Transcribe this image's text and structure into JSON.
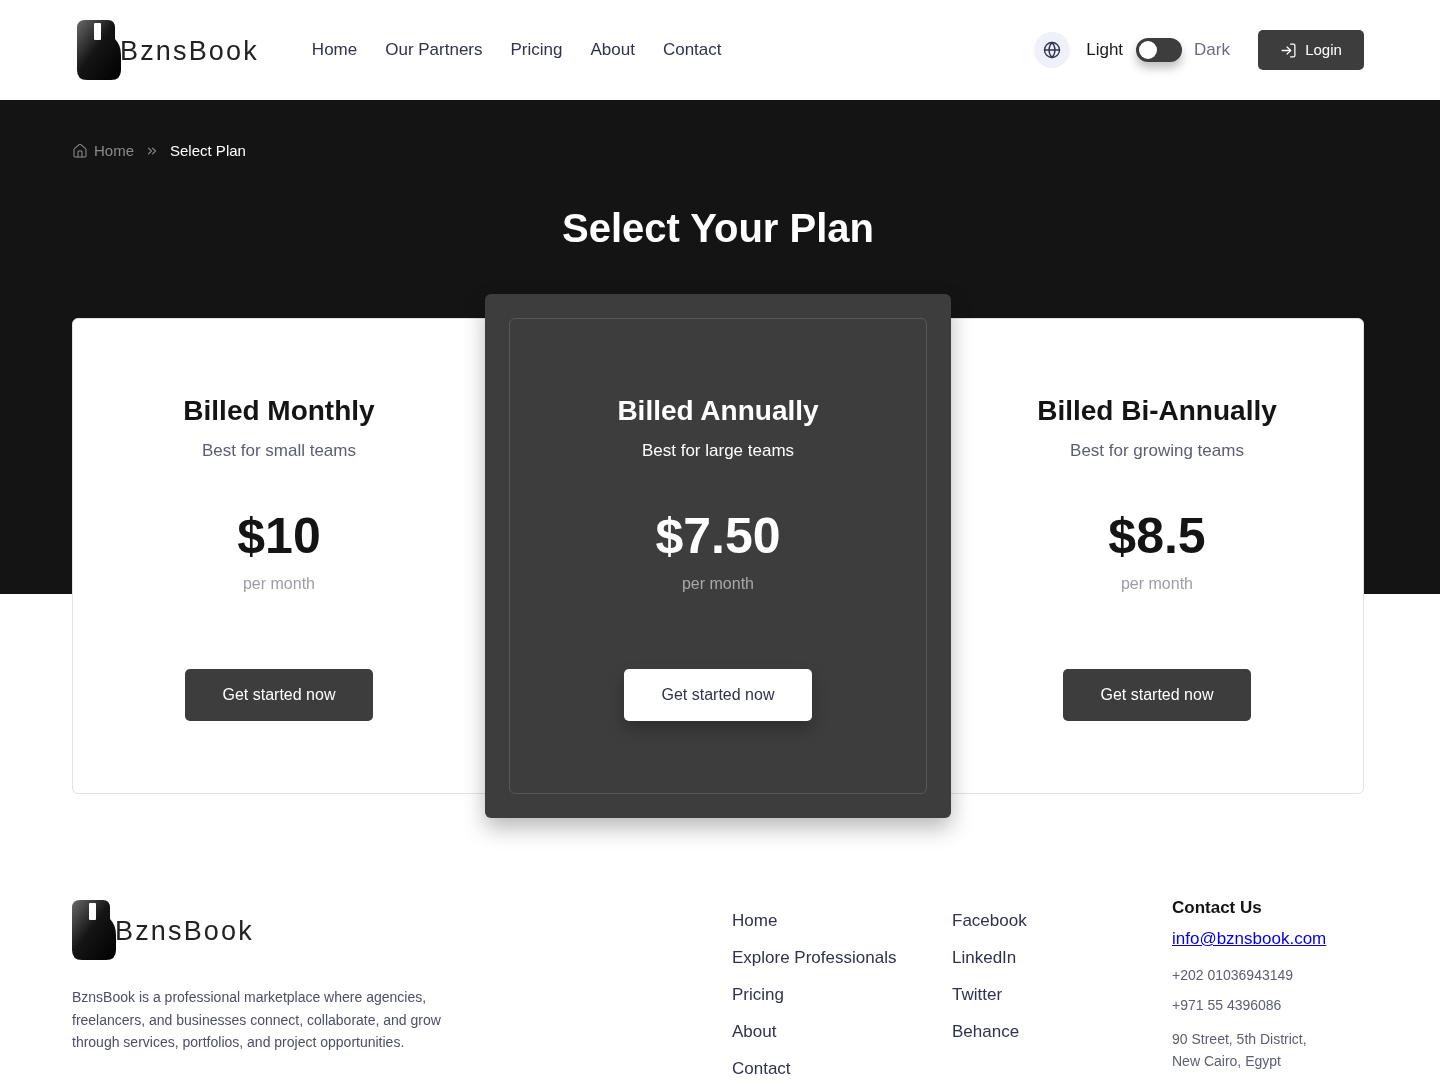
{
  "header": {
    "logo_text": "BznsBook",
    "nav": [
      "Home",
      "Our Partners",
      "Pricing",
      "About",
      "Contact"
    ],
    "theme_toggle": {
      "light_label": "Light",
      "dark_label": "Dark",
      "on": false
    },
    "login_button": "Login"
  },
  "breadcrumb": [
    {
      "label": "Home",
      "current": false
    },
    {
      "label": "Select Plan",
      "current": true
    }
  ],
  "title": "Select Your Plan",
  "plans": [
    {
      "name": "Billed Monthly",
      "subtitle": "Best for small teams",
      "price": "$10",
      "period": "per month",
      "button": "Get started now",
      "highlighted": false
    },
    {
      "name": "Billed Annually",
      "subtitle": "Best for large teams",
      "price": "$7.50",
      "period": "per month",
      "button": "Get started now",
      "highlighted": true
    },
    {
      "name": "Billed Bi-Annually",
      "subtitle": "Best for growing teams",
      "price": "$8.5",
      "period": "per month",
      "button": "Get started now",
      "highlighted": false
    }
  ],
  "footer": {
    "logo_text": "BznsBook",
    "description": "BznsBook is a professional marketplace where agencies, freelancers, and businesses connect, collaborate, and grow through services, portfolios, and project opportunities.",
    "links": [
      "Home",
      "Explore Professionals",
      "Pricing",
      "About",
      "Contact"
    ],
    "social": [
      "Facebook",
      "LinkedIn",
      "Twitter",
      "Behance"
    ],
    "contact": {
      "heading": "Contact Us",
      "email": "info@bznsbook.com",
      "phones": [
        "+202 01036943149",
        "+971 55 4396086"
      ],
      "address_lines": [
        "90 Street, 5th District,",
        "New Cairo, Egypt"
      ]
    }
  }
}
